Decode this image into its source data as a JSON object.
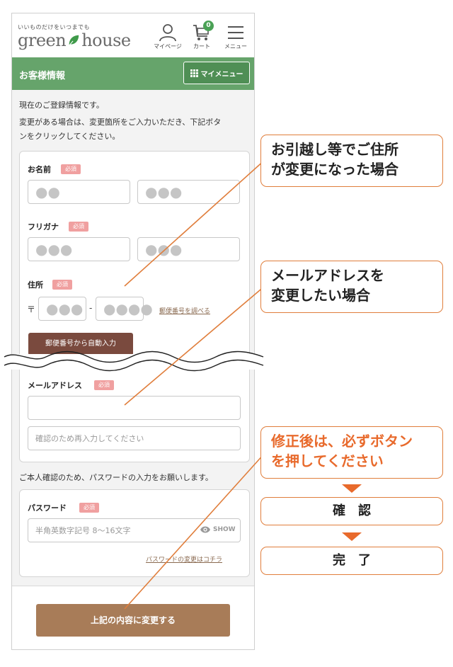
{
  "header": {
    "tagline": "いいものだけをいつまでも",
    "logo_left": "green",
    "logo_right": "house",
    "mypage_label": "マイページ",
    "cart_label": "カート",
    "cart_count": "0",
    "menu_label": "メニュー"
  },
  "section": {
    "title": "お客様情報",
    "mymenu_label": "マイメニュー"
  },
  "intro": {
    "line1": "現在のご登録情報です。",
    "line2": "変更がある場合は、変更箇所をご入力いただき、下記ボタ",
    "line3": "ンをクリックしてください。"
  },
  "form": {
    "required_label": "必須",
    "name": {
      "label": "お名前",
      "last": "●●",
      "first": "●●●"
    },
    "furigana": {
      "label": "フリガナ",
      "last": "●●●",
      "first": "●●●"
    },
    "address": {
      "label": "住所",
      "postal_mark": "〒",
      "zip1": "●●●",
      "dash": "-",
      "zip2": "●●●●",
      "lookup_link": "郵便番号を調べる",
      "autofill_button": "郵便番号から自動入力"
    },
    "email": {
      "label": "メールアドレス",
      "value": "",
      "confirm_placeholder": "確認のため再入力してください"
    },
    "password_intro": "ご本人確認のため、パスワードの入力をお願いします。",
    "password": {
      "label": "パスワード",
      "placeholder": "半角英数字記号 8〜16文字",
      "show_label": "SHOW",
      "change_link": "パスワードの変更はコチラ"
    },
    "submit_button": "上記の内容に変更する"
  },
  "annotations": {
    "move": [
      "お引越し等でご住所",
      "が変更になった場合"
    ],
    "email": [
      "メールアドレスを",
      "変更したい場合"
    ],
    "submit": [
      "修正後は、必ずボタン",
      "を押してください"
    ],
    "step_confirm": "確認",
    "step_done": "完了"
  },
  "colors": {
    "brand_green": "#66a46b",
    "annotation_orange": "#e86a2c",
    "submit_brown": "#a87c58",
    "autofill_brown": "#7a4a3e",
    "required_pink": "#f0a0a0"
  }
}
